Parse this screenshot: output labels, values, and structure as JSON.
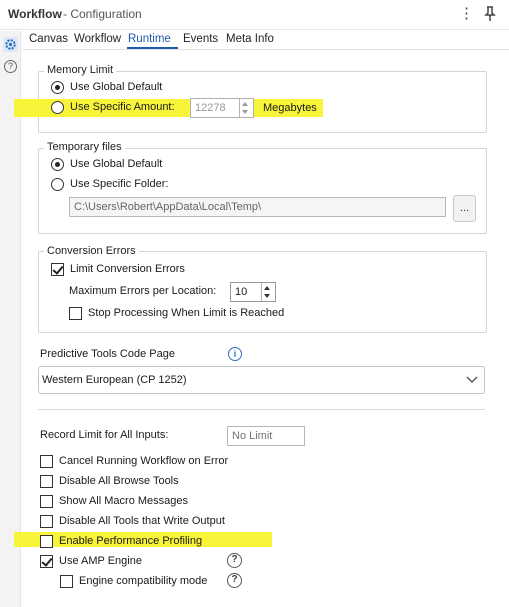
{
  "window": {
    "title": "Workflow",
    "subtitle": "- Configuration",
    "menu_icon": "⋮"
  },
  "tabs": [
    {
      "label": "Canvas"
    },
    {
      "label": "Workflow"
    },
    {
      "label": "Runtime"
    },
    {
      "label": "Events"
    },
    {
      "label": "Meta Info"
    }
  ],
  "memory_limit": {
    "title": "Memory Limit",
    "use_global_default": "Use Global Default",
    "use_specific_amount": "Use Specific Amount:",
    "amount_value": "12278",
    "unit": "Megabytes",
    "selected": "use_global_default"
  },
  "temporary_files": {
    "title": "Temporary files",
    "use_global_default": "Use Global Default",
    "use_specific_folder": "Use Specific Folder:",
    "folder_path": "C:\\Users\\Robert\\AppData\\Local\\Temp\\",
    "browse_label": "...",
    "selected": "use_global_default"
  },
  "conversion_errors": {
    "title": "Conversion Errors",
    "limit_conversion_errors": "Limit Conversion Errors",
    "limit_checked": true,
    "max_errors_label": "Maximum Errors per Location:",
    "max_errors_value": "10",
    "stop_processing": "Stop Processing When Limit is Reached",
    "stop_checked": false
  },
  "predictive": {
    "label": "Predictive Tools Code Page",
    "selected": "Western European (CP 1252)"
  },
  "record_limit": {
    "label": "Record Limit for All Inputs:",
    "placeholder": "No Limit"
  },
  "options": [
    {
      "label": "Cancel Running Workflow on Error",
      "checked": false
    },
    {
      "label": "Disable All Browse Tools",
      "checked": false
    },
    {
      "label": "Show All Macro Messages",
      "checked": false
    },
    {
      "label": "Disable All Tools that Write Output",
      "checked": false
    },
    {
      "label": "Enable Performance Profiling",
      "checked": false
    },
    {
      "label": "Use AMP Engine",
      "checked": true
    },
    {
      "label": "Engine compatibility mode",
      "checked": false
    }
  ],
  "highlight_color": "#f7f43a",
  "accent_color": "#1f5aa6"
}
